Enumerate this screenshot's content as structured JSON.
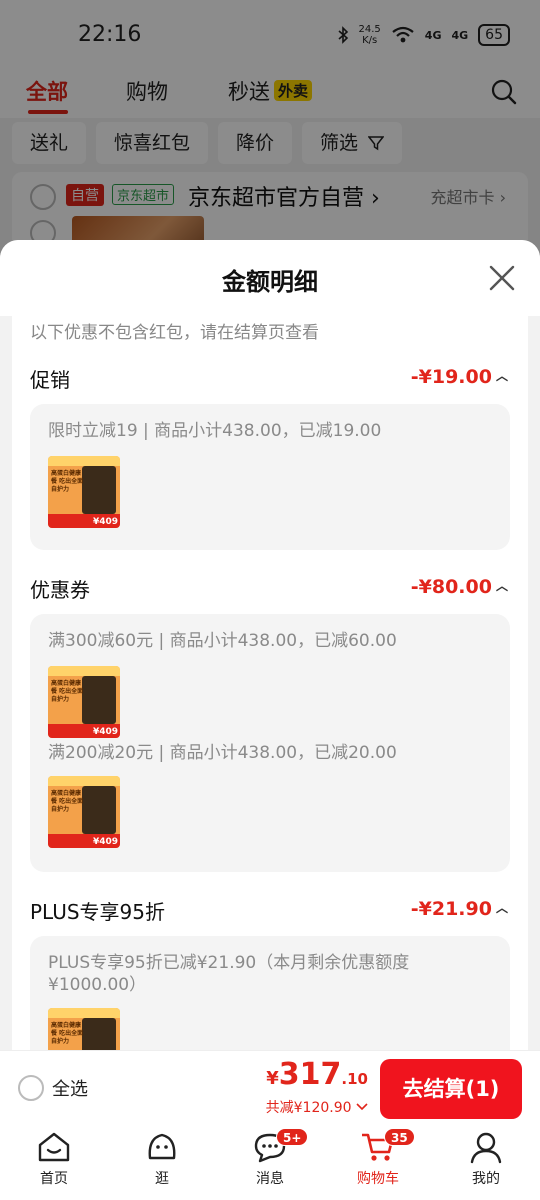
{
  "status_bar": {
    "time": "22:16",
    "net_speed_value": "24.5",
    "net_speed_unit": "K/s",
    "signal_1": "4G",
    "signal_2": "4G",
    "battery": "65"
  },
  "top_tabs": {
    "all": "全部",
    "shopping": "购物",
    "flash": "秒送",
    "flash_badge": "外卖"
  },
  "filter_chips": [
    "送礼",
    "惊喜红包",
    "降价",
    "筛选"
  ],
  "store": {
    "self_badge": "自营",
    "chaoshi_badge": "京东超市",
    "name": "京东超市官方自营",
    "recharge_link": "充超市卡"
  },
  "sheet": {
    "title": "金额明细",
    "notice": "以下优惠不包含红包，请在结算页查看",
    "sections": [
      {
        "title": "促销",
        "amount": "-¥19.00",
        "details": [
          "限时立减19 | 商品小计438.00，已减19.00"
        ]
      },
      {
        "title": "优惠券",
        "amount": "-¥80.00",
        "details": [
          "满300减60元 | 商品小计438.00，已减60.00",
          "满200减20元 | 商品小计438.00，已减20.00"
        ]
      },
      {
        "title": "PLUS专享95折",
        "amount": "-¥21.90",
        "details": [
          "PLUS专享95折已减¥21.90（本月剩余优惠额度¥1000.00）"
        ]
      }
    ],
    "product_thumb": {
      "headline": "高蛋白健康餐 吃出全面自护力",
      "price": "¥409"
    }
  },
  "action_bar": {
    "select_all": "全选",
    "price_symbol": "¥",
    "price_int": "317",
    "price_dec": ".10",
    "total_discount": "共减¥120.90",
    "checkout": "去结算(1)"
  },
  "bottom_nav": [
    {
      "label": "首页",
      "badge": ""
    },
    {
      "label": "逛",
      "badge": ""
    },
    {
      "label": "消息",
      "badge": "5+"
    },
    {
      "label": "购物车",
      "badge": "35"
    },
    {
      "label": "我的",
      "badge": ""
    }
  ],
  "colors": {
    "brand_red": "#e1251b",
    "checkout_red": "#f0141e",
    "chaoshi_green": "#2b9d4a",
    "waimai_yellow": "#ffd700"
  }
}
